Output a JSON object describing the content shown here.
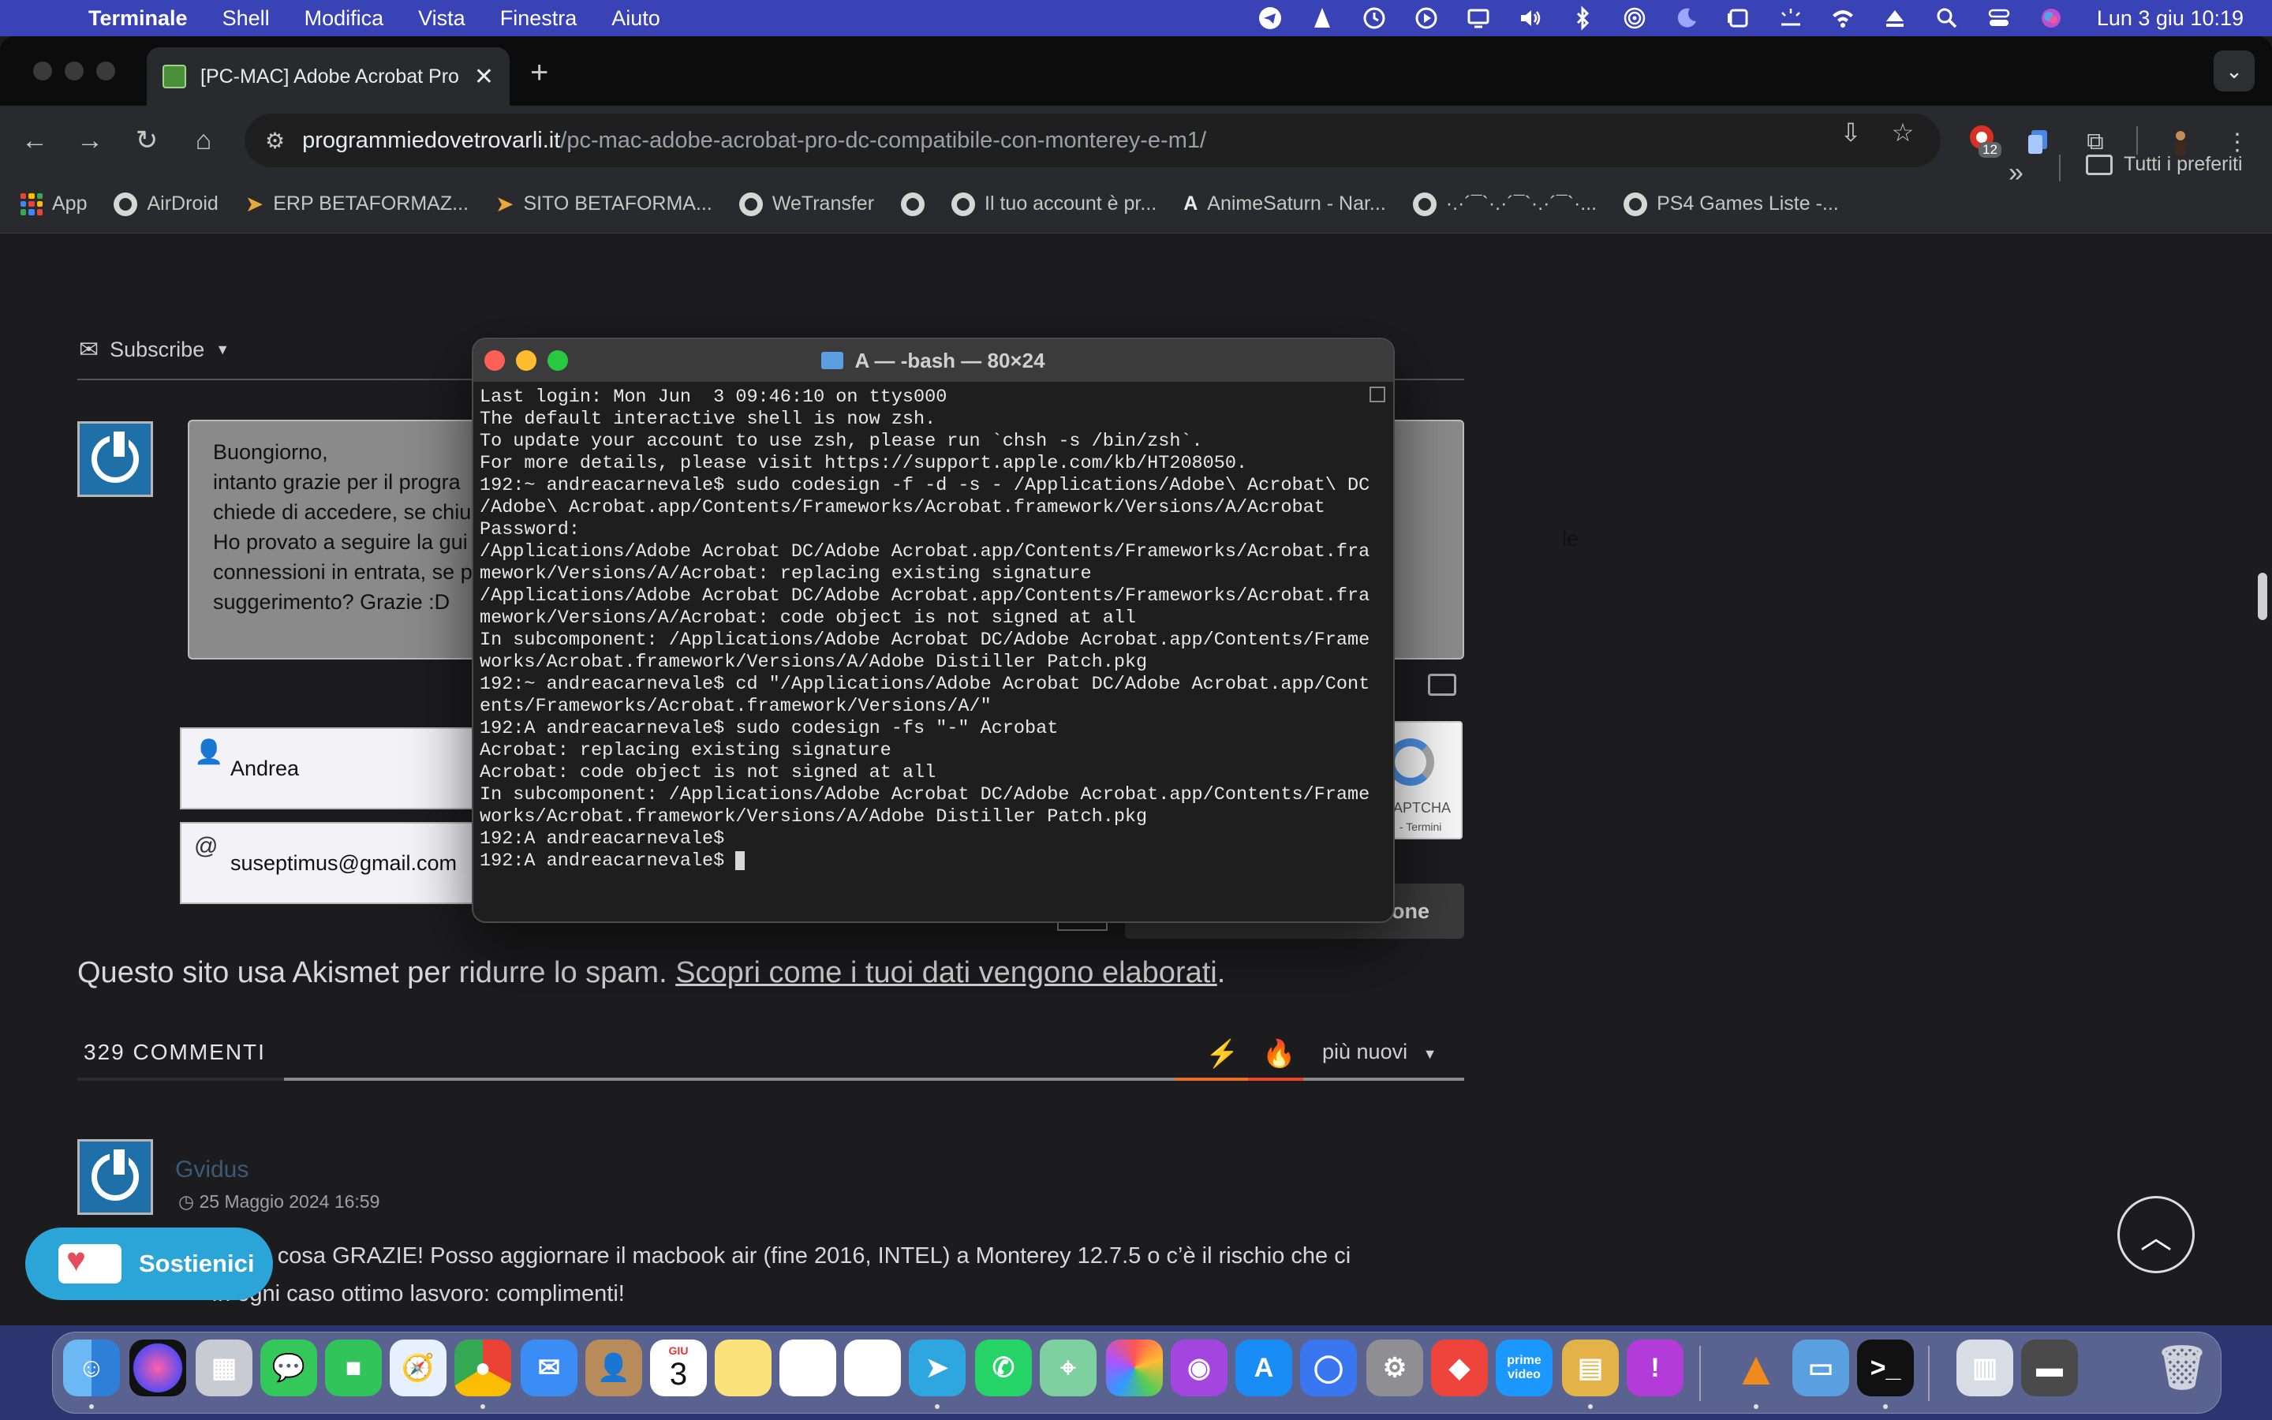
{
  "menubar": {
    "app_name": "Terminale",
    "menus": [
      "Shell",
      "Modifica",
      "Vista",
      "Finestra",
      "Aiuto"
    ],
    "clock": "Lun 3 giu  10:19"
  },
  "browser": {
    "tab_title": "[PC-MAC] Adobe Acrobat Pro",
    "tab_close": "✕",
    "new_tab": "+",
    "url_host": "programmiedovetrovarli.it",
    "url_path": "/pc-mac-adobe-acrobat-pro-dc-compatibile-con-monterey-e-m1/",
    "extension_badge": "12",
    "bookmarks": [
      "App",
      "AirDroid",
      "ERP BETAFORMAZ...",
      "SITO BETAFORMA...",
      "WeTransfer",
      "",
      "Il tuo account è pr...",
      "AnimeSaturn - Nar...",
      "·.·´¯`·.·´¯`·.·´¯`·...",
      "PS4 Games Liste -..."
    ],
    "bookmarks_more": "»",
    "all_bookmarks": "Tutti i preferiti"
  },
  "page": {
    "subscribe_label": "Subscribe",
    "comment_draft_lines": [
      "Buongiorno,",
      "intanto grazie per il progra",
      "chiede di accedere, se chiu",
      "Ho provato a seguire la gui",
      "connessioni in entrata, se p",
      "suggerimento? Grazie :D"
    ],
    "comment_draft_tail": "le",
    "name_field": "Andrea",
    "email_field": "suseptimus@gmail.com",
    "captcha_text": "APTCHA",
    "captcha_terms": "- Termini",
    "submit_label": "one",
    "akismet_text": "Questo sito usa Akismet per ridurre lo spam. ",
    "akismet_link": "Scopri come i tuoi dati vengono elaborati",
    "akismet_end": ".",
    "comments_count": "329 COMMENTI",
    "sort_label": "più nuovi",
    "comment": {
      "author": "Gvidus",
      "date": "25 Maggio 2024 16:59",
      "line1": "Prima cosa GRAZIE! Posso aggiornare il macbook air (fine 2016, INTEL) a Monterey 12.7.5 o c’è il rischio che ci",
      "line2": "In ogni caso ottimo lasvoro: complimenti!"
    },
    "donate_label": "Sostienici"
  },
  "terminal": {
    "title": "A — -bash — 80×24",
    "lines": [
      "Last login: Mon Jun  3 09:46:10 on ttys000",
      "",
      "The default interactive shell is now zsh.",
      "To update your account to use zsh, please run `chsh -s /bin/zsh`.",
      "For more details, please visit https://support.apple.com/kb/HT208050.",
      "192:~ andreacarnevale$ sudo codesign -f -d -s - /Applications/Adobe\\ Acrobat\\ DC",
      "/Adobe\\ Acrobat.app/Contents/Frameworks/Acrobat.framework/Versions/A/Acrobat",
      "Password:",
      "/Applications/Adobe Acrobat DC/Adobe Acrobat.app/Contents/Frameworks/Acrobat.fra",
      "mework/Versions/A/Acrobat: replacing existing signature",
      "/Applications/Adobe Acrobat DC/Adobe Acrobat.app/Contents/Frameworks/Acrobat.fra",
      "mework/Versions/A/Acrobat: code object is not signed at all",
      "In subcomponent: /Applications/Adobe Acrobat DC/Adobe Acrobat.app/Contents/Frame",
      "works/Acrobat.framework/Versions/A/Adobe Distiller Patch.pkg",
      "192:~ andreacarnevale$ cd \"/Applications/Adobe Acrobat DC/Adobe Acrobat.app/Cont",
      "ents/Frameworks/Acrobat.framework/Versions/A/\"",
      "192:A andreacarnevale$ sudo codesign -fs \"-\" Acrobat",
      "Acrobat: replacing existing signature",
      "Acrobat: code object is not signed at all",
      "In subcomponent: /Applications/Adobe Acrobat DC/Adobe Acrobat.app/Contents/Frame",
      "works/Acrobat.framework/Versions/A/Adobe Distiller Patch.pkg",
      "192:A andreacarnevale$",
      "192:A andreacarnevale$ "
    ]
  },
  "dock": {
    "calendar_month": "GIU",
    "calendar_day": "3",
    "prime_label": "prime video"
  }
}
